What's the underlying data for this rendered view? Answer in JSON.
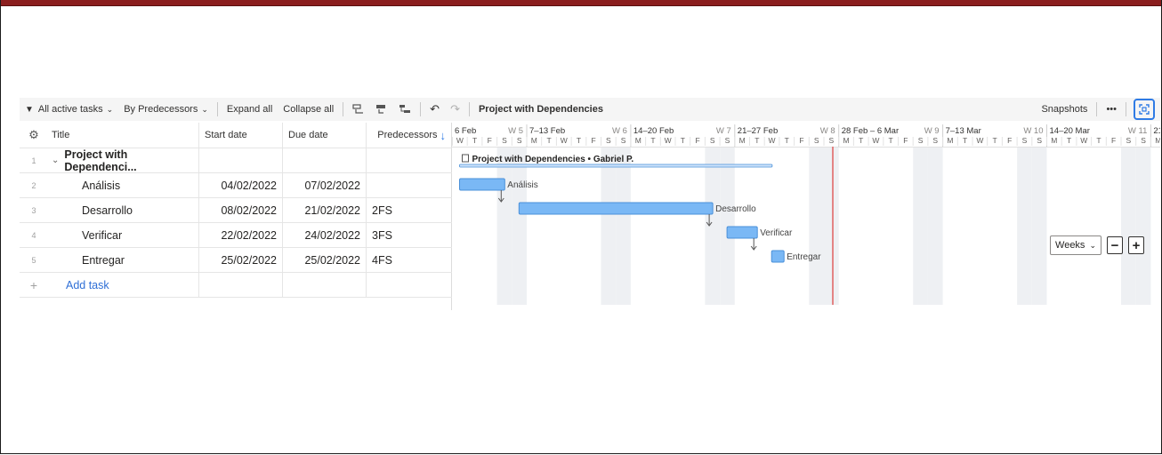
{
  "toolbar": {
    "filter_label": "All active tasks",
    "group_label": "By Predecessors",
    "expand_label": "Expand all",
    "collapse_label": "Collapse all",
    "plan_name": "Project with Dependencies",
    "snapshots_label": "Snapshots",
    "more_label": "•••"
  },
  "grid": {
    "headers": {
      "title": "Title",
      "start": "Start date",
      "due": "Due date",
      "pred": "Predecessors"
    },
    "rows": [
      {
        "num": "1",
        "title": "Project with Dependenci...",
        "start": "",
        "due": "",
        "pred": "",
        "summary": true
      },
      {
        "num": "2",
        "title": "Análisis",
        "start": "04/02/2022",
        "due": "07/02/2022",
        "pred": ""
      },
      {
        "num": "3",
        "title": "Desarrollo",
        "start": "08/02/2022",
        "due": "21/02/2022",
        "pred": "2FS"
      },
      {
        "num": "4",
        "title": "Verificar",
        "start": "22/02/2022",
        "due": "24/02/2022",
        "pred": "3FS"
      },
      {
        "num": "5",
        "title": "Entregar",
        "start": "25/02/2022",
        "due": "25/02/2022",
        "pred": "4FS"
      }
    ],
    "add_label": "Add task",
    "add_icon": "+"
  },
  "timeline": {
    "first_day": "2022-02-04",
    "weeks": [
      {
        "label": "6 Feb",
        "num": "W 5"
      },
      {
        "label": "7–13 Feb",
        "num": "W 6"
      },
      {
        "label": "14–20 Feb",
        "num": "W 7"
      },
      {
        "label": "21–27 Feb",
        "num": "W 8"
      },
      {
        "label": "28 Feb – 6 Mar",
        "num": "W 9"
      },
      {
        "label": "7–13 Mar",
        "num": "W 10"
      },
      {
        "label": "14–20 Mar",
        "num": "W 11"
      },
      {
        "label": "21",
        "num": ""
      }
    ],
    "day_letters": [
      "W",
      "T",
      "F",
      "S",
      "S",
      "M",
      "T",
      "W",
      "T",
      "F",
      "S",
      "S",
      "M",
      "T",
      "W",
      "T",
      "F",
      "S",
      "S",
      "M",
      "T",
      "W",
      "T",
      "F",
      "S",
      "S",
      "M",
      "T",
      "W",
      "T",
      "F",
      "S",
      "S",
      "M",
      "T",
      "W",
      "T",
      "F",
      "S",
      "S",
      "M",
      "T",
      "W",
      "T",
      "F",
      "S",
      "S",
      "M",
      "T",
      "W",
      "T",
      "F",
      "S",
      "S",
      "M"
    ],
    "today": "2022-03-01",
    "summary_label": "Project with Dependencies • Gabriel P.",
    "bars": [
      {
        "label": "Análisis",
        "start": "2022-02-04",
        "end": "2022-02-07"
      },
      {
        "label": "Desarrollo",
        "start": "2022-02-08",
        "end": "2022-02-21"
      },
      {
        "label": "Verificar",
        "start": "2022-02-22",
        "end": "2022-02-24"
      },
      {
        "label": "Entregar",
        "start": "2022-02-25",
        "end": "2022-02-25"
      }
    ],
    "zoom_unit": "Weeks"
  },
  "colors": {
    "bar": "#7ab8f5",
    "bar_border": "#4a90d9",
    "weekend": "#eef0f3",
    "today": "#e06060",
    "accent": "#2f7be5"
  }
}
